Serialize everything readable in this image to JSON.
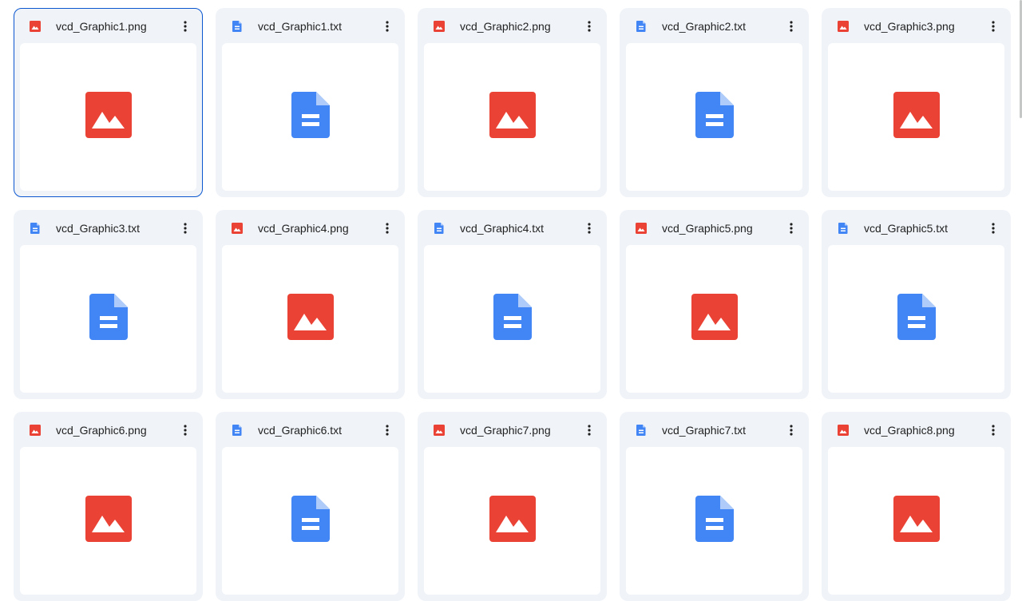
{
  "files": [
    {
      "name": "vcd_Graphic1.png",
      "type": "image",
      "selected": true
    },
    {
      "name": "vcd_Graphic1.txt",
      "type": "text",
      "selected": false
    },
    {
      "name": "vcd_Graphic2.png",
      "type": "image",
      "selected": false
    },
    {
      "name": "vcd_Graphic2.txt",
      "type": "text",
      "selected": false
    },
    {
      "name": "vcd_Graphic3.png",
      "type": "image",
      "selected": false
    },
    {
      "name": "vcd_Graphic3.txt",
      "type": "text",
      "selected": false
    },
    {
      "name": "vcd_Graphic4.png",
      "type": "image",
      "selected": false
    },
    {
      "name": "vcd_Graphic4.txt",
      "type": "text",
      "selected": false
    },
    {
      "name": "vcd_Graphic5.png",
      "type": "image",
      "selected": false
    },
    {
      "name": "vcd_Graphic5.txt",
      "type": "text",
      "selected": false
    },
    {
      "name": "vcd_Graphic6.png",
      "type": "image",
      "selected": false
    },
    {
      "name": "vcd_Graphic6.txt",
      "type": "text",
      "selected": false
    },
    {
      "name": "vcd_Graphic7.png",
      "type": "image",
      "selected": false
    },
    {
      "name": "vcd_Graphic7.txt",
      "type": "text",
      "selected": false
    },
    {
      "name": "vcd_Graphic8.png",
      "type": "image",
      "selected": false
    }
  ],
  "icons": {
    "image": "image-file-icon",
    "text": "text-file-icon",
    "more": "more-vert-icon"
  },
  "colors": {
    "image_red": "#ea4335",
    "doc_blue": "#4285f4",
    "tile_bg": "#f0f4f9",
    "selected_border": "#0b57d0"
  }
}
